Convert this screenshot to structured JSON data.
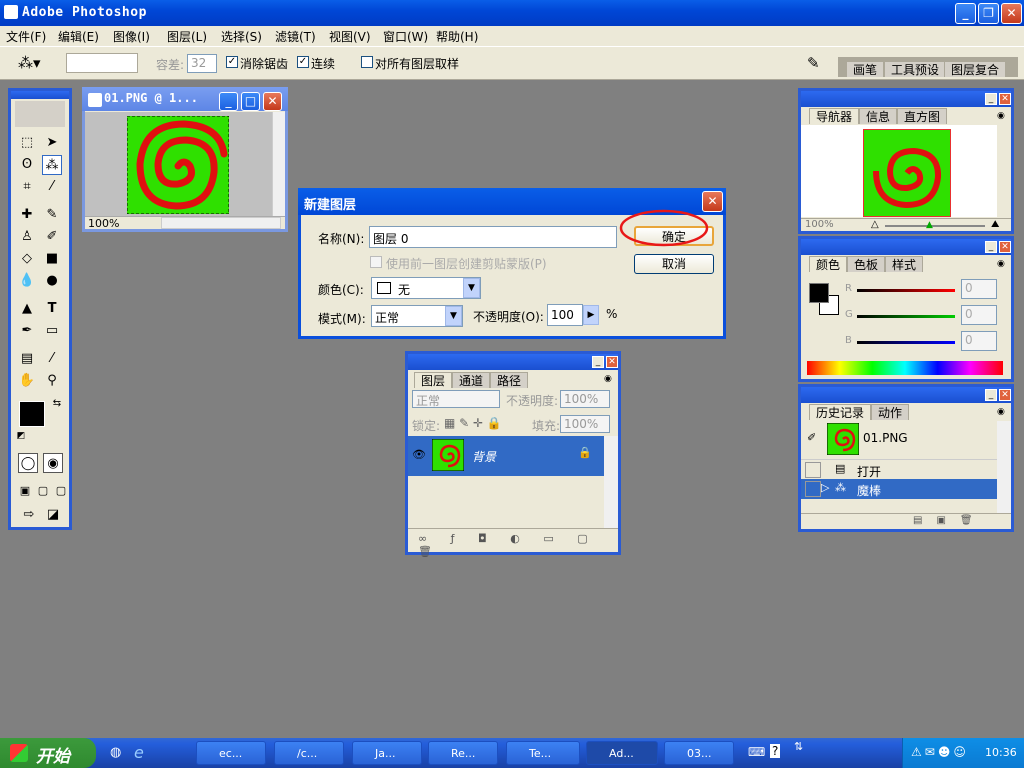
{
  "app": {
    "title": "Adobe Photoshop"
  },
  "menu": [
    "文件(F)",
    "编辑(E)",
    "图像(I)",
    "图层(L)",
    "选择(S)",
    "滤镜(T)",
    "视图(V)",
    "窗口(W)",
    "帮助(H)"
  ],
  "options": {
    "tolerance_label": "容差:",
    "tolerance_value": "32",
    "antialias_label": "消除锯齿",
    "contiguous_label": "连续",
    "sample_all_label": "对所有图层取样",
    "tab_brush": "画笔",
    "tab_tool_presets": "工具预设",
    "tab_layer_comps": "图层复合"
  },
  "doc": {
    "title": "01.PNG @ 1...",
    "zoom": "100%"
  },
  "dialog": {
    "title": "新建图层",
    "name_label": "名称(N):",
    "name_value": "图层 0",
    "clip_label": "使用前一图层创建剪贴蒙版(P)",
    "color_label": "颜色(C):",
    "color_value": "无",
    "mode_label": "模式(M):",
    "mode_value": "正常",
    "opacity_label": "不透明度(O):",
    "opacity_value": "100",
    "percent": "%",
    "ok": "确定",
    "cancel": "取消"
  },
  "layers": {
    "tabs": [
      "图层",
      "通道",
      "路径"
    ],
    "blend": "正常",
    "opacity_label": "不透明度:",
    "opacity_value": "100%",
    "lock_label": "锁定:",
    "fill_label": "填充:",
    "fill_value": "100%",
    "layer_name": "背景"
  },
  "navigator": {
    "tabs": [
      "导航器",
      "信息",
      "直方图"
    ],
    "zoom": "100%"
  },
  "color": {
    "tabs": [
      "颜色",
      "色板",
      "样式"
    ],
    "r_label": "R",
    "g_label": "G",
    "b_label": "B",
    "r": "0",
    "g": "0",
    "b": "0"
  },
  "history": {
    "tabs": [
      "历史记录",
      "动作"
    ],
    "snapshot": "01.PNG",
    "items": [
      "打开",
      "魔棒"
    ]
  },
  "taskbar": {
    "start": "开始",
    "items": [
      "ec...",
      "/c...",
      "Ja...",
      "Re...",
      "Te...",
      "Ad...",
      "03..."
    ],
    "time": "10:36"
  },
  "colors": {
    "accent": "#0a5ee8",
    "canvas_green": "#2fe000",
    "spiral_red": "#e01010",
    "highlight": "#e81818"
  }
}
